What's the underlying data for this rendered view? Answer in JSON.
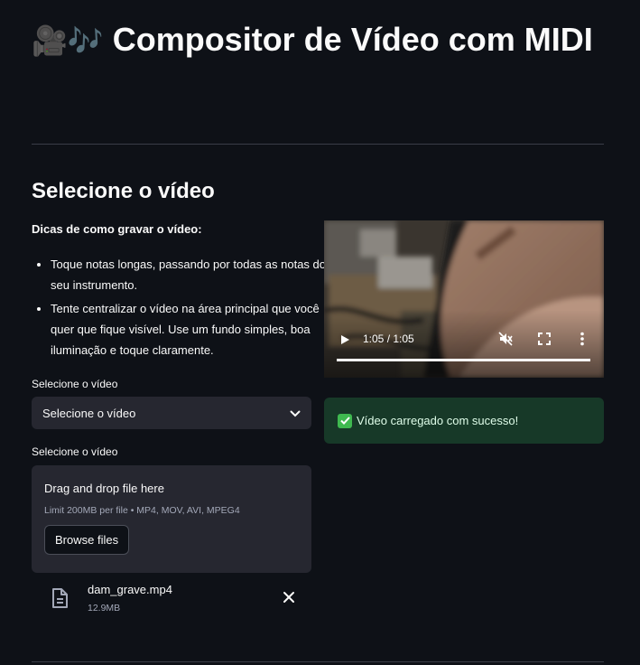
{
  "header": {
    "emoji": "🎥🎶",
    "title": "Compositor de Vídeo com MIDI"
  },
  "section": {
    "title": "Selecione o vídeo"
  },
  "tips": {
    "title": "Dicas de como gravar o vídeo:",
    "items": [
      "Toque notas longas, passando por todas as notas do seu instrumento.",
      "Tente centralizar o vídeo na área principal que você quer que fique visível. Use um fundo simples, boa iluminação e toque claramente."
    ]
  },
  "select": {
    "label": "Selecione o vídeo",
    "value": "Selecione o vídeo"
  },
  "uploader": {
    "label": "Selecione o vídeo",
    "drop_text": "Drag and drop file here",
    "limit_text": "Limit 200MB per file • MP4, MOV, AVI, MPEG4",
    "browse_label": "Browse files"
  },
  "file": {
    "name": "dam_grave.mp4",
    "size": "12.9MB"
  },
  "video": {
    "time": "1:05 / 1:05",
    "progress": 1.0
  },
  "status": {
    "message": "Vídeo carregado com sucesso!"
  },
  "colors": {
    "background": "#0e1117",
    "panel": "#262730",
    "success_bg": "#173928",
    "success_icon": "#3fb950"
  }
}
